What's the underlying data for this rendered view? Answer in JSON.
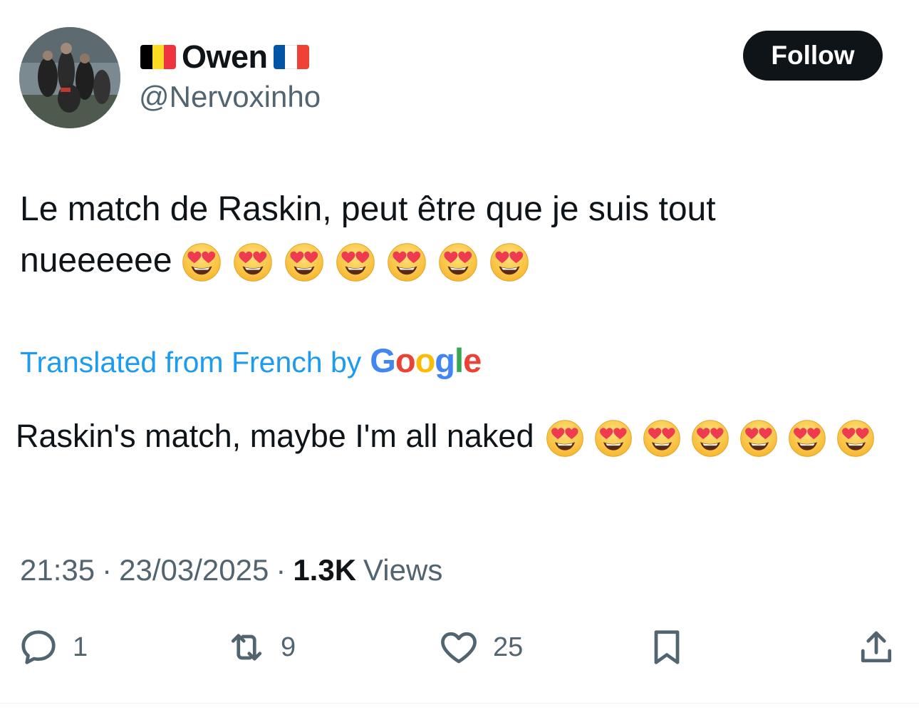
{
  "author": {
    "display_name": "Owen",
    "handle": "@Nervoxinho",
    "flag_left": "belgium-flag",
    "flag_right": "france-flag"
  },
  "follow_button": {
    "label": "Follow"
  },
  "tweet": {
    "text": "Le match de Raskin, peut être que je suis tout nueeeeee",
    "emoji_count": 7
  },
  "translation": {
    "label": "Translated from French by",
    "provider": "Google",
    "text": "Raskin's match, maybe I'm all naked",
    "emoji_count": 7
  },
  "meta": {
    "time": "21:35",
    "date": "23/03/2025",
    "views_count": "1.3K",
    "views_label": "Views"
  },
  "actions": {
    "replies": "1",
    "reposts": "9",
    "likes": "25"
  },
  "colors": {
    "text": "#0f1419",
    "secondary": "#536471",
    "link": "#1d9bf0",
    "button_bg": "#0f1419"
  }
}
